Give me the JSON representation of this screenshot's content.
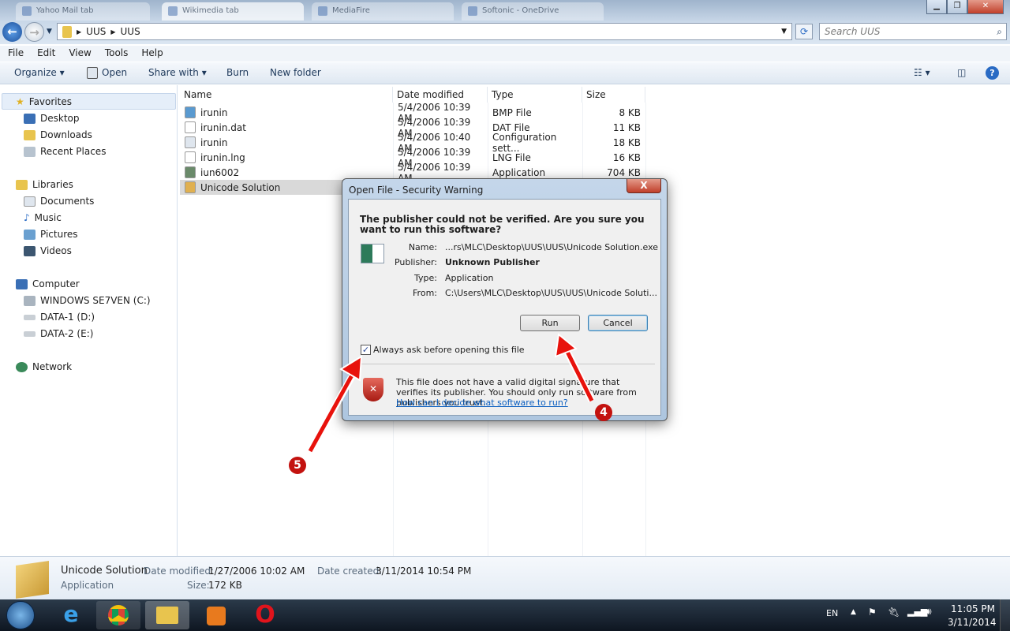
{
  "window": {
    "tabs": [
      "Yahoo Mail tab",
      "Wikimedia tab",
      "MediaFire",
      "Softonic - OneDrive"
    ]
  },
  "address": {
    "crumbs": [
      "UUS",
      "UUS"
    ],
    "search_placeholder": "Search UUS"
  },
  "menu": [
    "File",
    "Edit",
    "View",
    "Tools",
    "Help"
  ],
  "toolbar": {
    "organize": "Organize ▾",
    "open": "Open",
    "share": "Share with ▾",
    "burn": "Burn",
    "new_folder": "New folder"
  },
  "sidebar": {
    "favorites": "Favorites",
    "fav_items": [
      "Desktop",
      "Downloads",
      "Recent Places"
    ],
    "libraries": "Libraries",
    "lib_items": [
      "Documents",
      "Music",
      "Pictures",
      "Videos"
    ],
    "computer": "Computer",
    "comp_items": [
      "WINDOWS SE7VEN (C:)",
      "DATA-1 (D:)",
      "DATA-2 (E:)"
    ],
    "network": "Network"
  },
  "columns": [
    "Name",
    "Date modified",
    "Type",
    "Size"
  ],
  "files": [
    {
      "name": "irunin",
      "date": "5/4/2006 10:39 AM",
      "type": "BMP File",
      "size": "8 KB"
    },
    {
      "name": "irunin.dat",
      "date": "5/4/2006 10:39 AM",
      "type": "DAT File",
      "size": "11 KB"
    },
    {
      "name": "irunin",
      "date": "5/4/2006 10:40 AM",
      "type": "Configuration sett...",
      "size": "18 KB"
    },
    {
      "name": "irunin.lng",
      "date": "5/4/2006 10:39 AM",
      "type": "LNG File",
      "size": "16 KB"
    },
    {
      "name": "iun6002",
      "date": "5/4/2006 10:39 AM",
      "type": "Application",
      "size": "704 KB"
    },
    {
      "name": "Unicode Solution",
      "date": "",
      "type": "Application",
      "size": ""
    }
  ],
  "details": {
    "name": "Unicode Solution",
    "type": "Application",
    "modified_label": "Date modified:",
    "modified": "1/27/2006 10:02 AM",
    "created_label": "Date created:",
    "created": "3/11/2014 10:54 PM",
    "size_label": "Size:",
    "size": "172 KB"
  },
  "dialog": {
    "title": "Open File - Security Warning",
    "close": "X",
    "heading": "The publisher could not be verified.  Are you sure you want to run this software?",
    "name_label": "Name:",
    "name": "...rs\\MLC\\Desktop\\UUS\\UUS\\Unicode Solution.exe",
    "publisher_label": "Publisher:",
    "publisher": "Unknown Publisher",
    "type_label": "Type:",
    "type": "Application",
    "from_label": "From:",
    "from": "C:\\Users\\MLC\\Desktop\\UUS\\UUS\\Unicode Soluti...",
    "run": "Run",
    "cancel": "Cancel",
    "checkbox_label": "Always ask before opening this file",
    "checkbox_checked": true,
    "warning": "This file does not have a valid digital signature that verifies its publisher.  You should only run software from publishers you trust.",
    "link": "How can I decide what software to run?"
  },
  "annotations": {
    "badge_run": "4",
    "badge_checkbox": "5",
    "arrow_color": "#e8120c"
  },
  "tray": {
    "lang": "EN",
    "time": "11:05 PM",
    "date": "3/11/2014"
  }
}
